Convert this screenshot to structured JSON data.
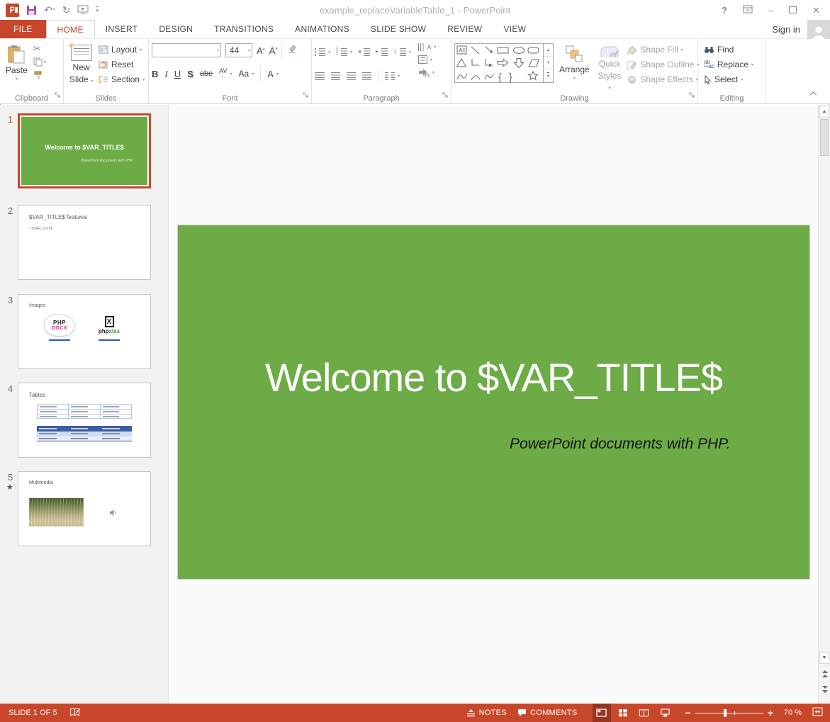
{
  "title_bar": {
    "title": "example_replaceVariableTable_1 - PowerPoint",
    "sign_in": "Sign in"
  },
  "tabs": {
    "file": "FILE",
    "items": [
      "HOME",
      "INSERT",
      "DESIGN",
      "TRANSITIONS",
      "ANIMATIONS",
      "SLIDE SHOW",
      "REVIEW",
      "VIEW"
    ]
  },
  "ribbon": {
    "clipboard": {
      "label": "Clipboard",
      "paste": "Paste"
    },
    "slides": {
      "label": "Slides",
      "new_slide_1": "New",
      "new_slide_2": "Slide",
      "layout": "Layout",
      "reset": "Reset",
      "section": "Section"
    },
    "font": {
      "label": "Font",
      "size": "44",
      "bold": "B",
      "italic": "I",
      "underline": "U",
      "shadow": "S",
      "strike": "abe",
      "spacing": "AV",
      "case": "Aa",
      "color": "A",
      "grow": "A",
      "shrink": "A"
    },
    "paragraph": {
      "label": "Paragraph"
    },
    "drawing": {
      "label": "Drawing",
      "arrange": "Arrange",
      "quick_styles_1": "Quick",
      "quick_styles_2": "Styles",
      "shape_fill": "Shape Fill",
      "shape_outline": "Shape Outline",
      "shape_effects": "Shape Effects"
    },
    "editing": {
      "label": "Editing",
      "find": "Find",
      "replace": "Replace",
      "select": "Select"
    }
  },
  "thumbnails": {
    "s1": {
      "number": "1",
      "title": "Welcome to $VAR_TITLE$",
      "subtitle": "PowerPoint documents with PHP."
    },
    "s2": {
      "number": "2",
      "title": "$VAR_TITLE$ features",
      "bullet": "• $VAR_LIST$"
    },
    "s3": {
      "number": "3",
      "title": "Images",
      "logo1_top": "PHP",
      "logo1_bottom": "DOCX",
      "logo2_x": "X",
      "logo2_php": "php",
      "logo2_xlsx": "xlsx"
    },
    "s4": {
      "number": "4",
      "title": "Tables"
    },
    "s5": {
      "number": "5",
      "title": "Multimedia",
      "star": "★"
    }
  },
  "slide": {
    "title": "Welcome to $VAR_TITLE$",
    "subtitle": "PowerPoint documents with PHP."
  },
  "status_bar": {
    "slide_info": "SLIDE 1 OF 5",
    "notes": "NOTES",
    "comments": "COMMENTS",
    "zoom_level": "70 %"
  },
  "colors": {
    "accent": "#C8472B",
    "slide_green": "#6DAB47",
    "table_header_blue": "#3D5CA8"
  }
}
